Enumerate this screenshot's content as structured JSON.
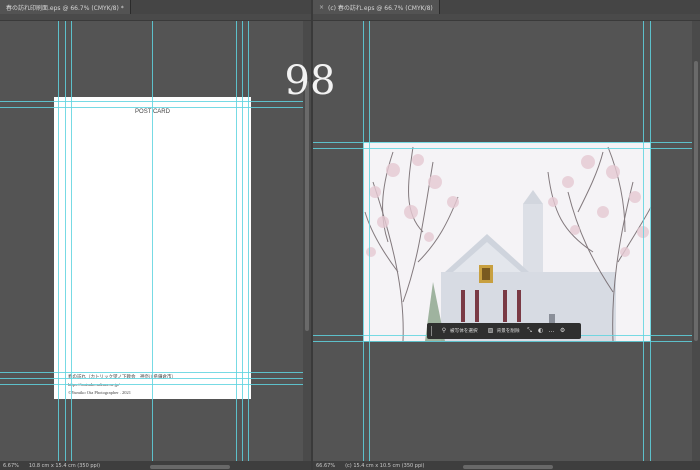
{
  "page_number": "98",
  "left_doc": {
    "tab_title": "春の訪れ印刷面.eps @ 66.7% (CMYK/8) *",
    "zoom": "6.67%",
    "size_info": "10.8 cm x 15.4 cm (350 ppi)",
    "postcard": {
      "title": "POST CARD",
      "caption": "春の訪れ（カトリック望ノ下教会　神奈川県鎌倉市）",
      "url": "https://tsutsuko.sakura.ne.jp/",
      "credit": "©Yumiko Ota Photographer . 2021"
    }
  },
  "right_doc": {
    "tab_title": "(c) 春の訪れ.eps @ 66.7% (CMYK/8)",
    "close_label": "×",
    "zoom": "66.67%",
    "size_info": "(c) 15.4 cm x 10.5 cm (350 ppi)"
  },
  "context_bar": {
    "select_subject": "被写体を選択",
    "remove_background": "背景を削除",
    "more_icon": "…"
  },
  "colors": {
    "guide": "#5fd3df",
    "workspace": "#545454"
  }
}
